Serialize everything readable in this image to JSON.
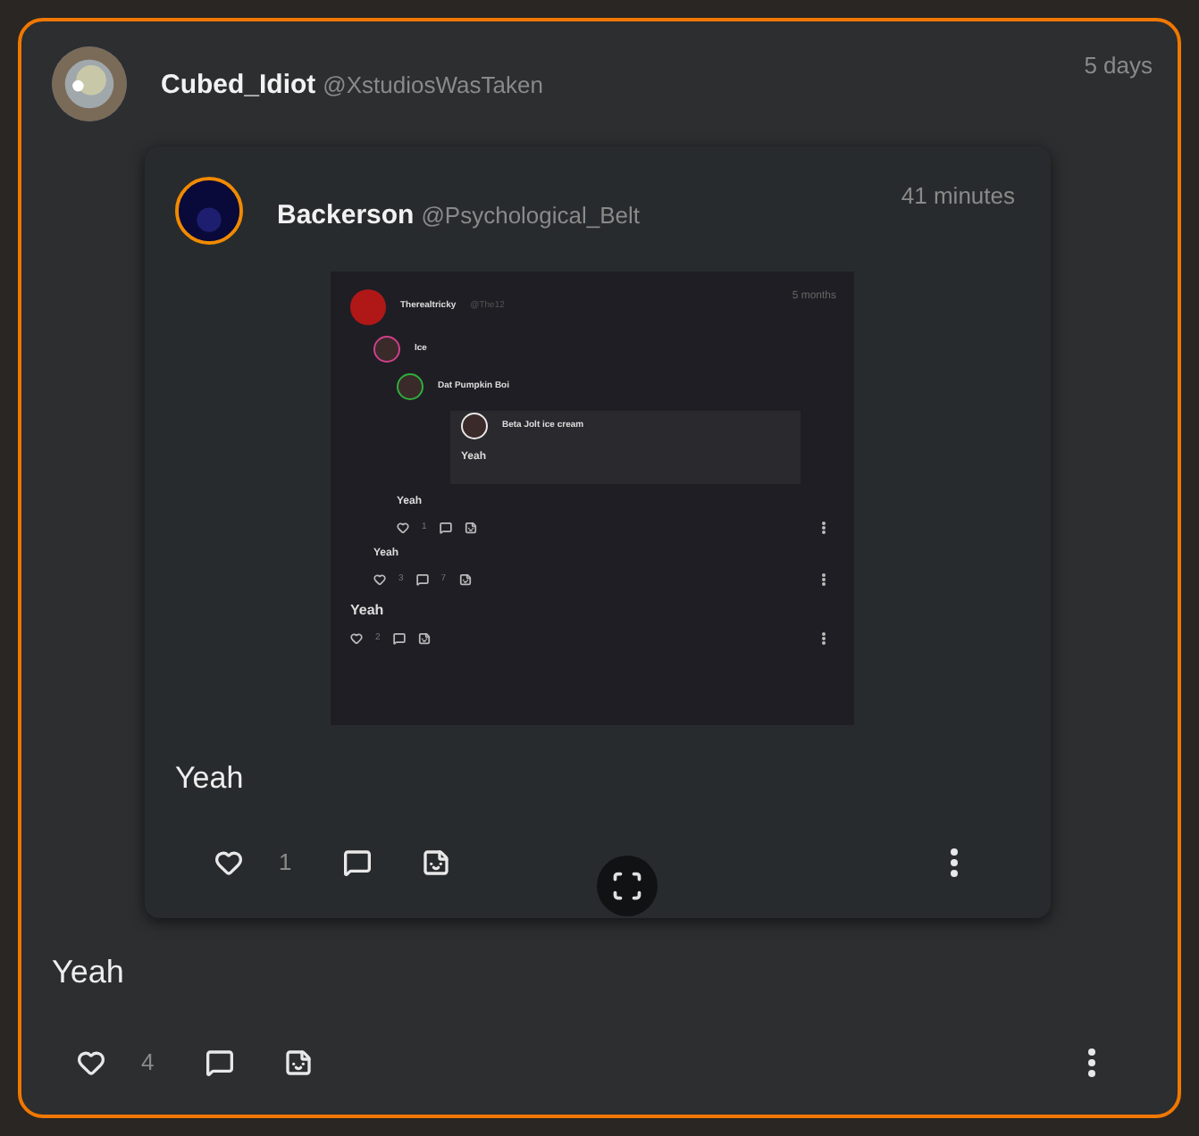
{
  "post": {
    "author": "Cubed_Idiot",
    "handle": "@XstudiosWasTaken",
    "time": "5 days",
    "ring": false,
    "quote": {
      "author": "Backerson",
      "handle": "@Psychological_Belt",
      "time": "41 minutes",
      "ring": true,
      "screenshot": {
        "kind": "plain",
        "author": "Therealtricky",
        "handle": "@The12",
        "time": "5 months",
        "color": "#b01818",
        "children": [
          {
            "kind": "plain",
            "author": "Ice",
            "color": "#d0408a",
            "text": "Yeah",
            "likes": "3",
            "comments": "7",
            "children": [
              {
                "kind": "plain",
                "author": "Dat Pumpkin Boi",
                "color": "#2fae3a",
                "text": "Yeah",
                "likes": "1",
                "children": [
                  {
                    "kind": "card",
                    "author": "Beta Jolt ice cream",
                    "color": "#e8e8e8",
                    "text": "Yeah"
                  }
                ]
              }
            ]
          }
        ],
        "text": "Yeah",
        "likes": "2"
      },
      "text": "Yeah",
      "likes": "1",
      "expand_button": true
    },
    "text": "Yeah",
    "likes": "4"
  }
}
